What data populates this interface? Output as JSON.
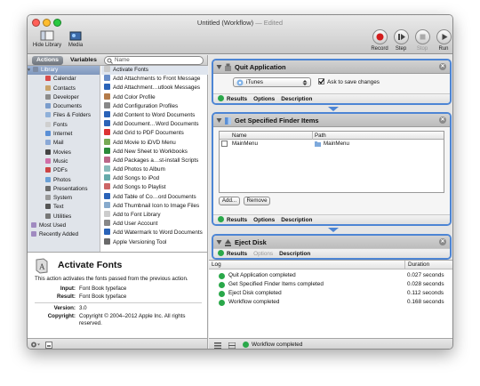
{
  "window": {
    "title": "Untitled (Workflow)",
    "title_suffix": "— Edited"
  },
  "toolbar": {
    "hide_library": "Hide Library",
    "media": "Media",
    "record": "Record",
    "step": "Step",
    "stop": "Stop",
    "run": "Run"
  },
  "library": {
    "tab_actions": "Actions",
    "tab_variables": "Variables",
    "search_placeholder": "Name",
    "categories": [
      "Library",
      "Calendar",
      "Contacts",
      "Developer",
      "Documents",
      "Files & Folders",
      "Fonts",
      "Internet",
      "Mail",
      "Movies",
      "Music",
      "PDFs",
      "Photos",
      "Presentations",
      "System",
      "Text",
      "Utilities",
      "Most Used",
      "Recently Added"
    ],
    "actions": [
      "Activate Fonts",
      "Add Attachments to Front Message",
      "Add Attachment…utlook Messages",
      "Add Color Profile",
      "Add Configuration Profiles",
      "Add Content to Word Documents",
      "Add Document…Word Documents",
      "Add Grid to PDF Documents",
      "Add Movie to iDVD Menu",
      "Add New Sheet to Workbooks",
      "Add Packages a…st-install Scripts",
      "Add Photos to Album",
      "Add Songs to iPod",
      "Add Songs to Playlist",
      "Add Table of Co…ord Documents",
      "Add Thumbnail Icon to Image Files",
      "Add to Font Library",
      "Add User Account",
      "Add Watermark to Word Documents",
      "Apple Versioning Tool"
    ]
  },
  "description": {
    "title": "Activate Fonts",
    "text": "This action activates the fonts passed from the previous action.",
    "input_label": "Input:",
    "input_value": "Font Book typeface",
    "result_label": "Result:",
    "result_value": "Font Book typeface",
    "version_label": "Version:",
    "version_value": "3.0",
    "copyright_label": "Copyright:",
    "copyright_value": "Copyright © 2004–2012 Apple Inc. All rights reserved."
  },
  "workflow": {
    "quit": {
      "title": "Quit Application",
      "app": "iTunes",
      "ask_label": "Ask to save changes",
      "ask_checked": true
    },
    "finder": {
      "title": "Get Specified Finder Items",
      "col_name": "Name",
      "col_path": "Path",
      "row_name": "MainMenu",
      "row_path": "MainMenu",
      "add": "Add...",
      "remove": "Remove"
    },
    "eject": {
      "title": "Eject Disk"
    },
    "footer": {
      "results": "Results",
      "options": "Options",
      "description": "Description"
    }
  },
  "log": {
    "col_log": "Log",
    "col_duration": "Duration",
    "rows": [
      {
        "text": "Quit Application completed",
        "duration": "0.027 seconds"
      },
      {
        "text": "Get Specified Finder Items completed",
        "duration": "0.028 seconds"
      },
      {
        "text": "Eject Disk completed",
        "duration": "0.112 seconds"
      },
      {
        "text": "Workflow completed",
        "duration": "0.168 seconds"
      }
    ]
  },
  "status": {
    "text": "Workflow completed"
  }
}
